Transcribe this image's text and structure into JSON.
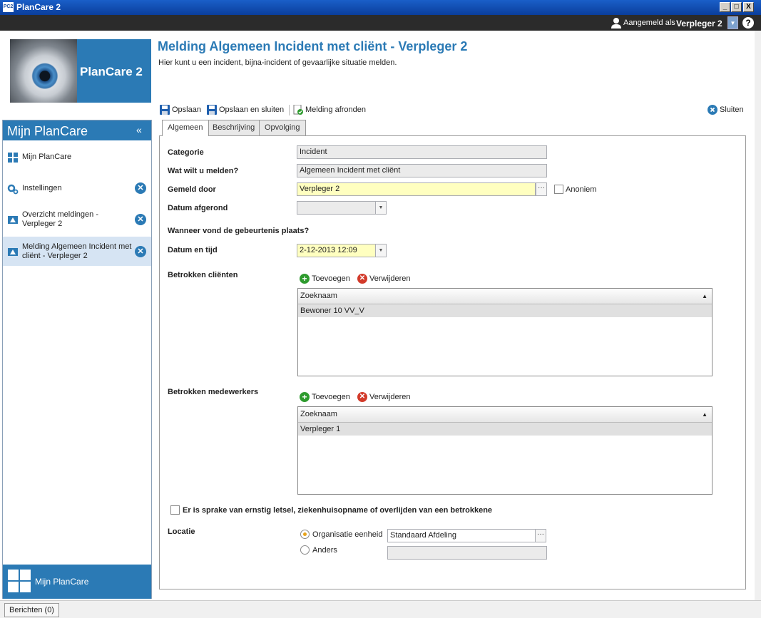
{
  "window": {
    "app_icon": "PC2",
    "title": "PlanCare 2",
    "buttons": [
      "_",
      "□",
      "X"
    ]
  },
  "topbar": {
    "logged_in_label": "Aangemeld als",
    "user": "Verpleger 2",
    "help": "?"
  },
  "brand": {
    "name": "PlanCare 2"
  },
  "sidebar": {
    "title": "Mijn PlanCare",
    "collapse": "«",
    "items": [
      {
        "label": "Mijn PlanCare"
      },
      {
        "label": "Instellingen"
      },
      {
        "label": "Overzicht meldingen - Verpleger 2"
      },
      {
        "label": "Melding Algemeen Incident met cliënt - Verpleger 2"
      }
    ],
    "footer": "Mijn PlanCare"
  },
  "page": {
    "title": "Melding Algemeen Incident met cliënt - Verpleger 2",
    "subtitle": "Hier kunt u een incident, bijna-incident of gevaarlijke situatie melden."
  },
  "toolbar": {
    "save": "Opslaan",
    "save_close": "Opslaan en sluiten",
    "finish": "Melding afronden",
    "close": "Sluiten"
  },
  "tabs": [
    "Algemeen",
    "Beschrijving",
    "Opvolging"
  ],
  "form": {
    "categorie_label": "Categorie",
    "categorie_value": "Incident",
    "melden_label": "Wat wilt u melden?",
    "melden_value": "Algemeen Incident met cliënt",
    "gemeld_label": "Gemeld door",
    "gemeld_value": "Verpleger 2",
    "anoniem_label": "Anoniem",
    "afgerond_label": "Datum afgerond",
    "afgerond_value": "",
    "wanneer_label": "Wanneer vond de gebeurtenis plaats?",
    "datum_label": "Datum en tijd",
    "datum_value": "2-12-2013 12:09",
    "clienten_label": "Betrokken cliënten",
    "add_label": "Toevoegen",
    "remove_label": "Verwijderen",
    "grid_col": "Zoeknaam",
    "clienten_rows": [
      "Bewoner 10 VV_V"
    ],
    "medewerkers_label": "Betrokken medewerkers",
    "medewerkers_rows": [
      "Verpleger 1"
    ],
    "ernstig_label": "Er is sprake van ernstig letsel, ziekenhuisopname of overlijden van een betrokkene",
    "locatie_label": "Locatie",
    "org_label": "Organisatie eenheid",
    "org_value": "Standaard Afdeling",
    "anders_label": "Anders",
    "anders_value": ""
  },
  "status": {
    "berichten": "Berichten (0)"
  }
}
